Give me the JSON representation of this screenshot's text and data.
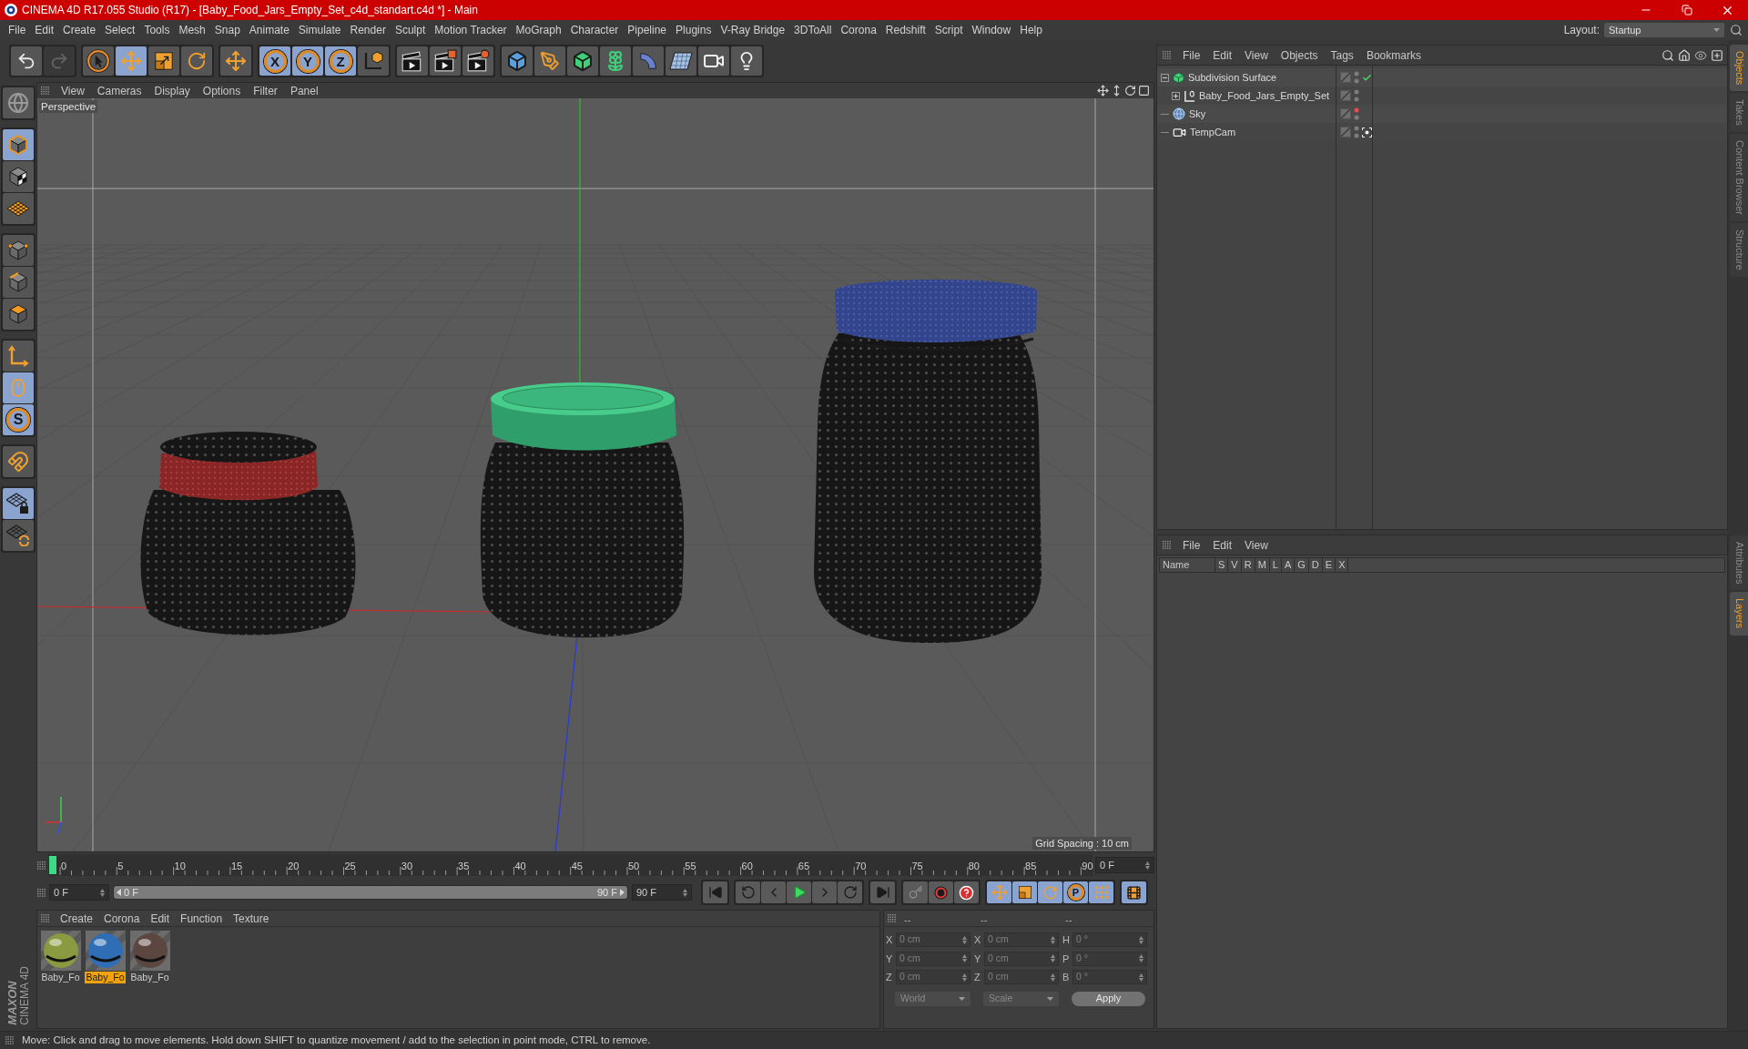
{
  "window": {
    "title": "CINEMA 4D R17.055 Studio (R17) - [Baby_Food_Jars_Empty_Set_c4d_standart.c4d *] - Main"
  },
  "menu_bar": [
    "File",
    "Edit",
    "Create",
    "Select",
    "Tools",
    "Mesh",
    "Snap",
    "Animate",
    "Simulate",
    "Render",
    "Sculpt",
    "Motion Tracker",
    "MoGraph",
    "Character",
    "Pipeline",
    "Plugins",
    "V-Ray Bridge",
    "3DToAll",
    "Corona",
    "Redshift",
    "Script",
    "Window",
    "Help"
  ],
  "layout": {
    "label": "Layout:",
    "value": "Startup"
  },
  "toolbar": [
    {
      "selected": false,
      "disabled": false
    },
    {
      "selected": false,
      "disabled": true
    },
    {
      "selected": false,
      "disabled": false
    },
    {
      "selected": true,
      "disabled": false
    },
    {
      "selected": false,
      "disabled": false
    },
    {
      "selected": false,
      "disabled": false
    },
    {
      "selected": false,
      "disabled": false
    },
    {
      "label": "X",
      "selected": true,
      "disabled": false
    },
    {
      "label": "Y",
      "selected": true,
      "disabled": false
    },
    {
      "label": "Z",
      "selected": true,
      "disabled": false
    },
    {
      "selected": false,
      "disabled": false
    },
    {
      "selected": false,
      "disabled": false
    },
    {
      "selected": false,
      "disabled": false
    },
    {
      "selected": false,
      "disabled": false
    },
    {
      "selected": false,
      "disabled": false
    },
    {
      "selected": false,
      "disabled": false
    },
    {
      "selected": false,
      "disabled": false
    },
    {
      "selected": false,
      "disabled": false
    },
    {
      "selected": false,
      "disabled": false
    },
    {
      "selected": false,
      "disabled": false
    },
    {
      "selected": false,
      "disabled": false
    },
    {
      "selected": false,
      "disabled": false
    }
  ],
  "left_toolbar": [
    {
      "selected": false
    },
    {
      "selected": true
    },
    {
      "selected": false
    },
    {
      "selected": false
    },
    {
      "selected": false
    },
    {
      "selected": false
    },
    {
      "selected": false
    },
    {
      "selected": false
    },
    {
      "selected": true
    },
    {
      "label": "S",
      "selected": true
    },
    {
      "selected": false
    },
    {
      "selected": true
    },
    {
      "selected": false
    }
  ],
  "brand": {
    "company": "MAXON",
    "product": "CINEMA 4D"
  },
  "viewport": {
    "menu": [
      "View",
      "Cameras",
      "Display",
      "Options",
      "Filter",
      "Panel"
    ],
    "camera": "Perspective",
    "grid_spacing": "Grid Spacing : 10 cm"
  },
  "timeline": {
    "ticks": [
      "0",
      "5",
      "10",
      "15",
      "20",
      "25",
      "30",
      "35",
      "40",
      "45",
      "50",
      "55",
      "60",
      "65",
      "70",
      "75",
      "80",
      "85",
      "90"
    ],
    "level": 0,
    "frame": "0 F"
  },
  "transport": {
    "current": "0 F",
    "range_slider": {
      "start": "0 F",
      "end": "90 F",
      "level": 1
    },
    "end": "90 F",
    "key_buttons": [
      {
        "selected": true
      },
      {
        "selected": true
      },
      {
        "selected": true
      },
      {
        "label": "P",
        "selected": true
      },
      {
        "selected": true
      }
    ],
    "film_button": {
      "selected": true
    }
  },
  "materials": {
    "menu": [
      "Create",
      "Corona",
      "Edit",
      "Function",
      "Texture"
    ],
    "items": [
      {
        "name": "Baby_Fo",
        "color": "#8a9a40",
        "selected": false
      },
      {
        "name": "Baby_Fo",
        "color": "#2f6db5",
        "selected": true
      },
      {
        "name": "Baby_Fo",
        "color": "#5b4640",
        "selected": false
      }
    ]
  },
  "coordinates": {
    "headers": [
      "--",
      "--",
      "--"
    ],
    "rows": [
      [
        {
          "label": "X",
          "value": "0 cm"
        },
        {
          "label": "X",
          "value": "0 cm"
        },
        {
          "label": "H",
          "value": "0 °"
        }
      ],
      [
        {
          "label": "Y",
          "value": "0 cm"
        },
        {
          "label": "Y",
          "value": "0 cm"
        },
        {
          "label": "P",
          "value": "0 °"
        }
      ],
      [
        {
          "label": "Z",
          "value": "0 cm"
        },
        {
          "label": "Z",
          "value": "0 cm"
        },
        {
          "label": "B",
          "value": "0 °"
        }
      ]
    ],
    "dropdowns": [
      "World",
      "Scale"
    ],
    "apply": "Apply"
  },
  "object_manager": {
    "menu": [
      "File",
      "Edit",
      "View",
      "Objects",
      "Tags",
      "Bookmarks"
    ],
    "objects": [
      {
        "name": "Subdivision Surface",
        "kind": "subdivision",
        "expandable": true,
        "expanded": true,
        "hidden_in_editor": false,
        "enabled_check": true,
        "camera_switch": false,
        "children": [
          {
            "name": "Baby_Food_Jars_Empty_Set",
            "kind": "null",
            "expandable": true,
            "expanded": false,
            "hidden_in_editor": false,
            "enabled_check": false,
            "camera_switch": false
          }
        ]
      },
      {
        "name": "Sky",
        "kind": "sky",
        "expandable": false,
        "hidden_in_editor": true,
        "enabled_check": false,
        "camera_switch": false
      },
      {
        "name": "TempCam",
        "kind": "camera",
        "expandable": false,
        "hidden_in_editor": false,
        "enabled_check": false,
        "camera_switch": true
      }
    ]
  },
  "layer_manager": {
    "menu": [
      "File",
      "Edit",
      "View"
    ],
    "columns": [
      "Name",
      "S",
      "V",
      "R",
      "M",
      "L",
      "A",
      "G",
      "D",
      "E",
      "X"
    ]
  },
  "side_tabs": {
    "top": [
      {
        "label": "Objects",
        "selected": true
      },
      {
        "label": "Takes",
        "selected": false
      },
      {
        "label": "Content Browser",
        "selected": false
      },
      {
        "label": "Structure",
        "selected": false
      }
    ],
    "bottom": [
      {
        "label": "Attributes",
        "selected": false
      },
      {
        "label": "Layers",
        "selected": true
      }
    ]
  },
  "status_bar": {
    "message": "Move: Click and drag to move elements. Hold down SHIFT to quantize movement / add to the selection in point mode, CTRL to remove."
  }
}
